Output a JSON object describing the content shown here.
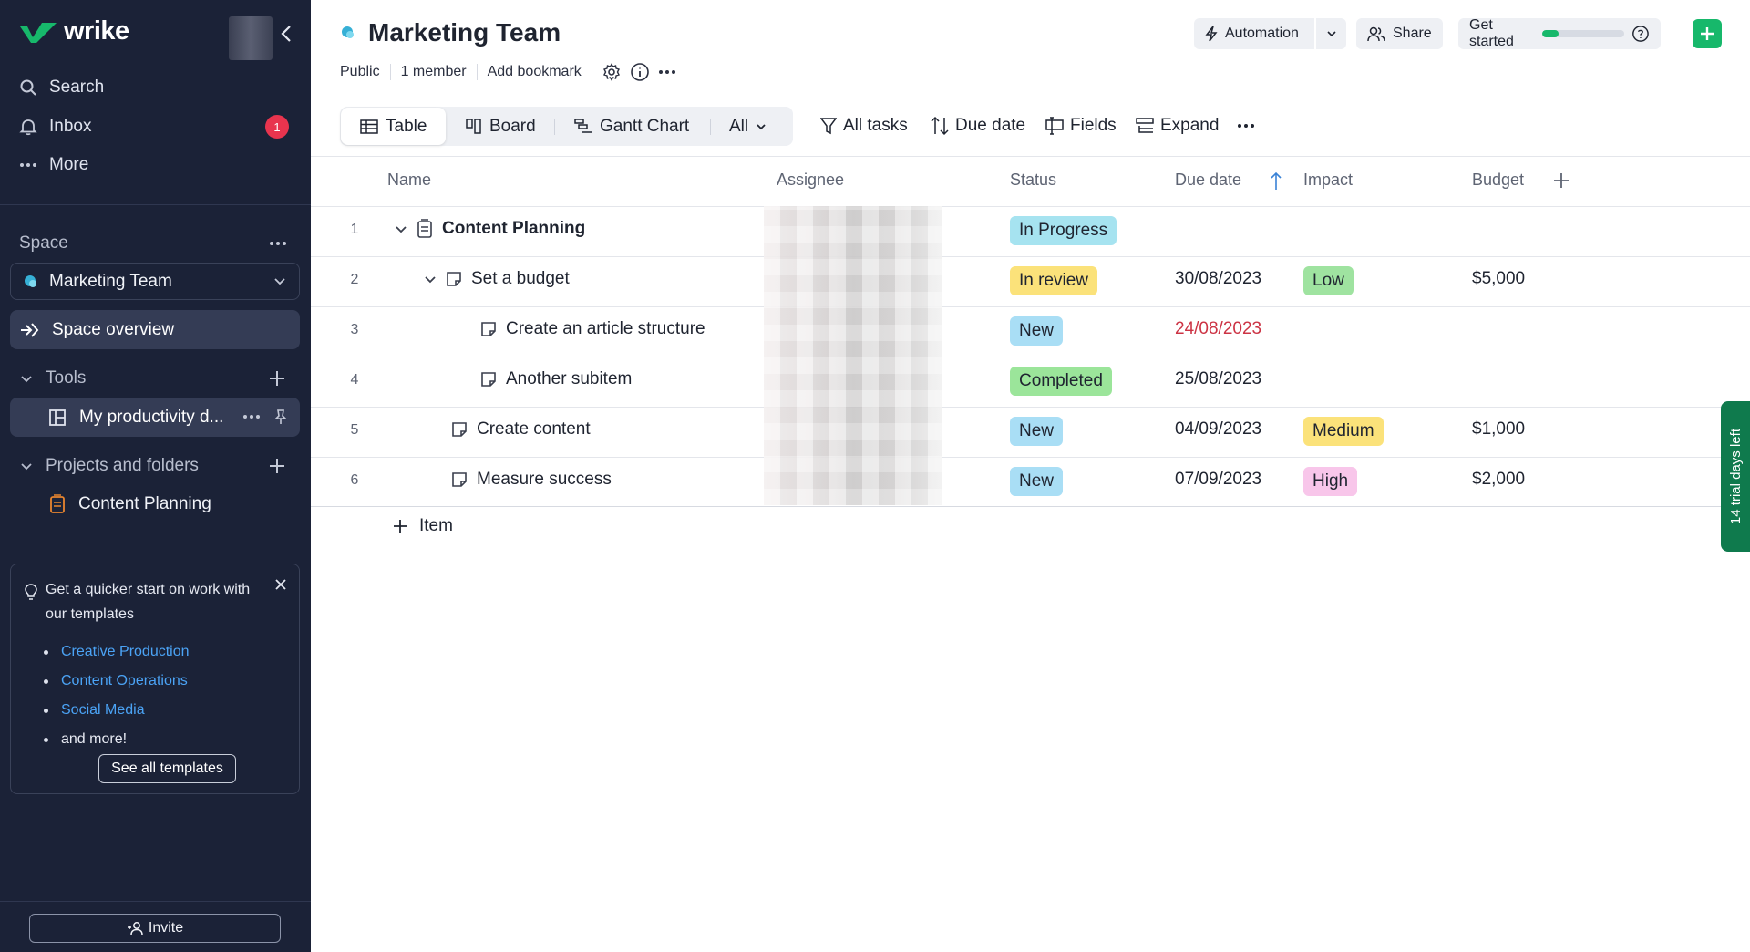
{
  "sidebar": {
    "logo": "wrike",
    "nav": {
      "search": "Search",
      "inbox": "Inbox",
      "inbox_badge": "1",
      "more": "More"
    },
    "space_label": "Space",
    "space_name": "Marketing Team",
    "space_overview": "Space overview",
    "tools_label": "Tools",
    "tool_item": "My productivity d...",
    "projects_label": "Projects and folders",
    "folder_item": "Content Planning",
    "promo": {
      "title": "Get a quicker start on work with our templates",
      "links": [
        "Creative Production",
        "Content Operations",
        "Social Media"
      ],
      "more": "and more!",
      "button": "See all templates"
    },
    "invite": "Invite"
  },
  "header": {
    "title": "Marketing Team",
    "meta": {
      "visibility": "Public",
      "members": "1 member",
      "bookmark": "Add bookmark"
    },
    "automation": "Automation",
    "share": "Share",
    "get_started": "Get started",
    "get_started_progress": 0.2
  },
  "views": {
    "table": "Table",
    "board": "Board",
    "gantt": "Gantt Chart",
    "filter": "All"
  },
  "toolbar": {
    "all_tasks": "All tasks",
    "due_date": "Due date",
    "fields": "Fields",
    "expand": "Expand"
  },
  "table": {
    "columns": {
      "name": "Name",
      "assignee": "Assignee",
      "status": "Status",
      "due": "Due date",
      "impact": "Impact",
      "budget": "Budget"
    },
    "rows": [
      {
        "num": "1",
        "name": "Content Planning",
        "status": "In Progress",
        "due": "",
        "impact": "",
        "budget": ""
      },
      {
        "num": "2",
        "name": "Set a budget",
        "status": "In review",
        "due": "30/08/2023",
        "impact": "Low",
        "budget": "$5,000"
      },
      {
        "num": "3",
        "name": "Create an article structure",
        "status": "New",
        "due": "24/08/2023",
        "impact": "",
        "budget": ""
      },
      {
        "num": "4",
        "name": "Another subitem",
        "status": "Completed",
        "due": "25/08/2023",
        "impact": "",
        "budget": ""
      },
      {
        "num": "5",
        "name": "Create content",
        "status": "New",
        "due": "04/09/2023",
        "impact": "Medium",
        "budget": "$1,000"
      },
      {
        "num": "6",
        "name": "Measure success",
        "status": "New",
        "due": "07/09/2023",
        "impact": "High",
        "budget": "$2,000"
      }
    ],
    "add_item": "Item"
  },
  "trial": "14 trial days left",
  "colors": {
    "sidebar_bg": "#1b2237",
    "accent_green": "#17b86b",
    "status_in_progress": "#a6e3f0",
    "status_in_review": "#fbe27a",
    "status_new": "#a9def5",
    "status_completed": "#9be59a",
    "impact_low": "#9fe3a0",
    "impact_medium": "#fbe27a",
    "impact_high": "#f8c6ea",
    "overdue": "#cc3344"
  }
}
